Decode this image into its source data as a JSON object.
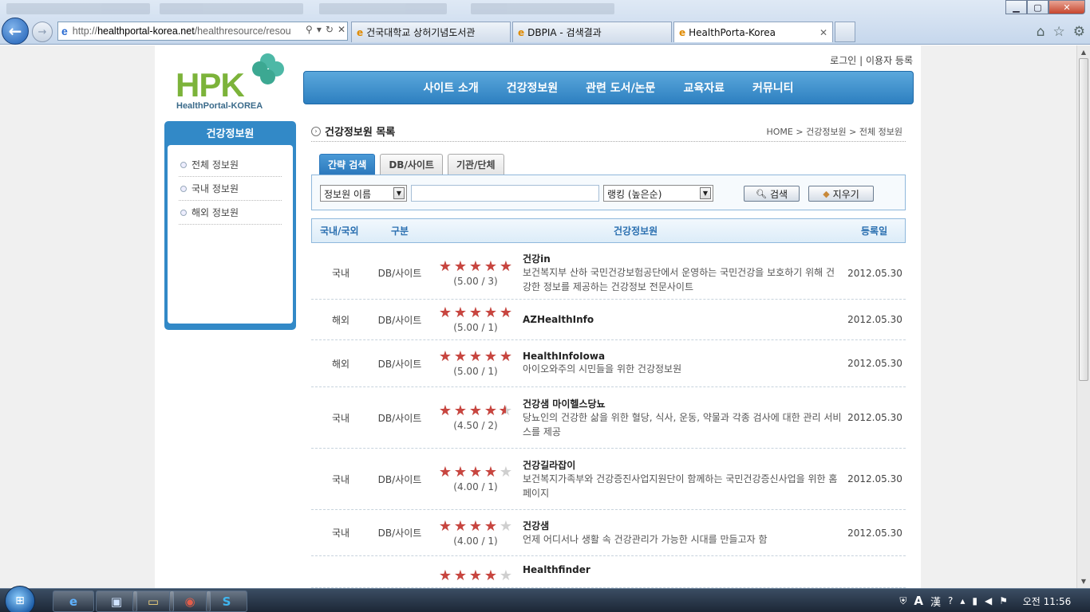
{
  "browser": {
    "url_host": "healthportal-korea.net",
    "url_prefix": "http://",
    "url_path": "/healthresource/resou",
    "tabs": [
      {
        "label": "건국대학교 상허기념도서관"
      },
      {
        "label": "DBPIA - 검색결과"
      },
      {
        "label": "HealthPorta-Korea"
      }
    ]
  },
  "header": {
    "logo_main": "HPK",
    "logo_sub": "HealthPortal-KOREA",
    "login": "로그인",
    "separator": "|",
    "register": "이용자 등록",
    "menu": [
      "사이트 소개",
      "건강정보원",
      "관련 도서/논문",
      "교육자료",
      "커뮤니티"
    ]
  },
  "sidebar": {
    "title": "건강정보원",
    "items": [
      {
        "label": "전체 정보원"
      },
      {
        "label": "국내 정보원"
      },
      {
        "label": "해외 정보원"
      }
    ]
  },
  "content": {
    "title": "건강정보원 목록",
    "breadcrumb": "HOME > 건강정보원 > 전체 정보원",
    "search_tabs": [
      {
        "label": "간략 검색"
      },
      {
        "label": "DB/사이트"
      },
      {
        "label": "기관/단체"
      }
    ],
    "search": {
      "field_select": "정보원 이름",
      "keyword": "",
      "sort_select": "랭킹 (높은순)",
      "search_button": "검색",
      "clear_button": "지우기"
    },
    "columns": {
      "region": "국내/국외",
      "type": "구분",
      "resource": "건강정보원",
      "date": "등록일"
    },
    "rows": [
      {
        "region": "국내",
        "type": "DB/사이트",
        "rating": 5.0,
        "rating_text": "(5.00 / 3)",
        "name": "건강in",
        "desc": "보건복지부 산하 국민건강보험공단에서 운영하는 국민건강을 보호하기 위해 건강한 정보를 제공하는 건강정보 전문사이트",
        "date": "2012.05.30"
      },
      {
        "region": "해외",
        "type": "DB/사이트",
        "rating": 5.0,
        "rating_text": "(5.00 / 1)",
        "name": "AZHealthInfo",
        "desc": "",
        "date": "2012.05.30"
      },
      {
        "region": "해외",
        "type": "DB/사이트",
        "rating": 5.0,
        "rating_text": "(5.00 / 1)",
        "name": "HealthInfoIowa",
        "desc": "아이오와주의 시민들을 위한 건강정보원",
        "date": "2012.05.30"
      },
      {
        "region": "국내",
        "type": "DB/사이트",
        "rating": 4.5,
        "rating_text": "(4.50 / 2)",
        "name": "건강샘 마이헬스당뇨",
        "desc": "당뇨인의 건강한 삶을 위한 혈당, 식사, 운동, 약물과 각종 검사에 대한 관리 서비스를 제공",
        "date": "2012.05.30"
      },
      {
        "region": "국내",
        "type": "DB/사이트",
        "rating": 4.0,
        "rating_text": "(4.00 / 1)",
        "name": "건강길라잡이",
        "desc": "보건복지가족부와 건강증진사업지원단이 함께하는 국민건강증신사업을 위한 홈페이지",
        "date": "2012.05.30"
      },
      {
        "region": "국내",
        "type": "DB/사이트",
        "rating": 4.0,
        "rating_text": "(4.00 / 1)",
        "name": "건강샘",
        "desc": "언제 어디서나 생활 속 건강관리가 가능한 시대를 만들고자 함",
        "date": "2012.05.30"
      },
      {
        "region": "",
        "type": "",
        "rating": 4.0,
        "rating_text": "",
        "name": "Healthfinder",
        "desc": "",
        "date": ""
      }
    ]
  },
  "taskbar": {
    "clock": "오전 11:56",
    "ime_a": "A",
    "ime_hanja": "漢"
  },
  "colors": {
    "accent_blue": "#2d7fc0",
    "star_red": "#c8453f",
    "logo_green": "#7cb33a",
    "clover_teal": "#4db8a6"
  }
}
